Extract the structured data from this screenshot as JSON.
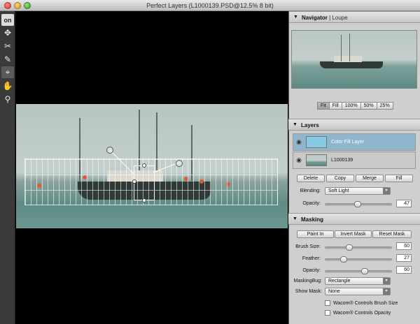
{
  "window": {
    "title": "Perfect Layers (L1000139.PSD@12.5% 8 bit)"
  },
  "toolbar": {
    "logo": "on",
    "tools": [
      "move-icon",
      "scissors-icon",
      "brush-icon",
      "transform-icon",
      "hand-icon",
      "zoom-icon"
    ],
    "active_tool": "transform-icon"
  },
  "navigator": {
    "title": "Navigator",
    "separator": "|",
    "loupe_tab": "Loupe",
    "zoom_buttons": [
      "Fit",
      "Fill",
      "100%",
      "50%",
      "25%"
    ],
    "active_zoom": "Fit"
  },
  "layers": {
    "title": "Layers",
    "items": [
      {
        "name": "Color Fill Layer",
        "selected": true,
        "thumb_color": "#86cbe3"
      },
      {
        "name": "L1000139",
        "selected": false
      }
    ],
    "buttons": [
      "Delete",
      "Copy",
      "Merge",
      "Fill"
    ],
    "blending_label": "Blending:",
    "blending_value": "Soft Light",
    "opacity_label": "Opacity:",
    "opacity_value": "47"
  },
  "masking": {
    "title": "Masking",
    "buttons": [
      "Paint In",
      "Invert Mask",
      "Reset Mask"
    ],
    "brush_size_label": "Brush Size:",
    "brush_size_value": "60",
    "feather_label": "Feather:",
    "feather_value": "27",
    "opacity_label": "Opacity:",
    "opacity_value": "60",
    "maskingbug_label": "MaskingBug:",
    "maskingbug_value": "Rectangle",
    "show_mask_label": "Show Mask:",
    "show_mask_value": "None",
    "wacom_brush_size": "Wacom® Controls Brush Size",
    "wacom_opacity": "Wacom® Controls Opacity"
  },
  "colors": {
    "selected_layer": "#8fb6cc",
    "panel": "#cfcfcf",
    "canvas": "#000000"
  }
}
